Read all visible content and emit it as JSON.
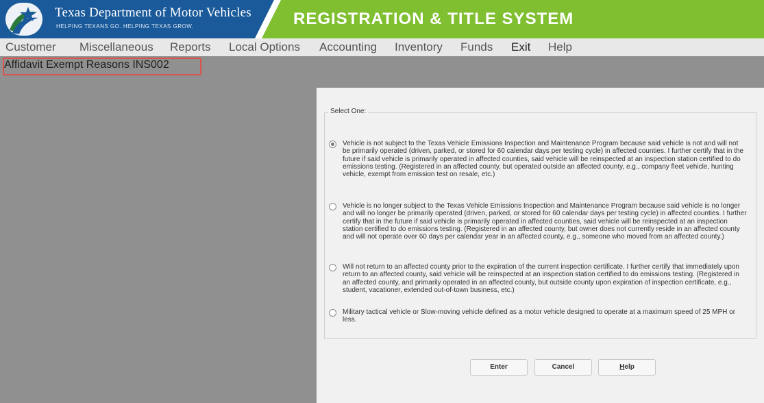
{
  "header": {
    "agency_title": "Texas Department of Motor Vehicles",
    "agency_tagline": "HELPING TEXANS GO. HELPING TEXAS GROW.",
    "system_title": "REGISTRATION & TITLE SYSTEM",
    "logo_icon": "txdmv-star-logo-icon",
    "colors": {
      "brand_blue": "#1a5a9a",
      "banner_green": "#7fbf30"
    }
  },
  "menu": {
    "items": [
      {
        "label": "Customer"
      },
      {
        "label": "Miscellaneous"
      },
      {
        "label": "Reports"
      },
      {
        "label": "Local Options"
      },
      {
        "label": "Accounting"
      },
      {
        "label": "Inventory"
      },
      {
        "label": "Funds"
      },
      {
        "label": "Exit"
      },
      {
        "label": "Help"
      }
    ]
  },
  "page": {
    "title": "Affidavit Exempt Reasons INS002",
    "highlight_color": "#d9534f"
  },
  "dialog": {
    "legend": "Select One:",
    "options": [
      {
        "selected": true,
        "text": "Vehicle is not subject to the Texas Vehicle Emissions Inspection and Maintenance Program because said vehicle is not and will not be primarily operated (driven, parked, or stored for 60 calendar days per testing cycle) in affected counties. I further certify that in the future if said vehicle is primarily operated in affected counties, said vehicle will be reinspected at an inspection station certified to do emissions testing. (Registered in an affected county, but operated outside an affected county, e.g., company fleet vehicle, hunting vehicle, exempt from emission test on resale, etc.)"
      },
      {
        "selected": false,
        "text": "Vehicle is no longer subject to the Texas Vehicle Emissions Inspection and Maintenance Program because said vehicle is no longer and will no longer be primarily operated (driven, parked, or stored for 60 calendar days per testing cycle) in affected counties. I further certify that in the future if said vehicle is primarily operated in affected counties, said vehicle will be reinspected at an inspection station certified to do emissions testing. (Registered in an affected county, but owner does not currently reside in an affected county and will not operate over 60 days per calendar year in an affected county, e.g., someone who moved from an affected county.)"
      },
      {
        "selected": false,
        "text": "Will not return to an affected county prior to the expiration of the current inspection certificate. I further certify that immediately upon return to an affected county, said vehicle will be reinspected at an inspection station certified to do emissions testing. (Registered in an affected county, and primarily operated in an affected county, but outside county upon expiration of inspection certificate, e.g., student, vacationer, extended out-of-town business, etc.)"
      },
      {
        "selected": false,
        "text": "Military tactical vehicle or Slow-moving vehicle defined as a motor vehicle designed to operate at a maximum speed of 25 MPH or less."
      }
    ],
    "buttons": {
      "enter": "Enter",
      "cancel": "Cancel",
      "help_first": "H",
      "help_rest": "elp"
    }
  }
}
